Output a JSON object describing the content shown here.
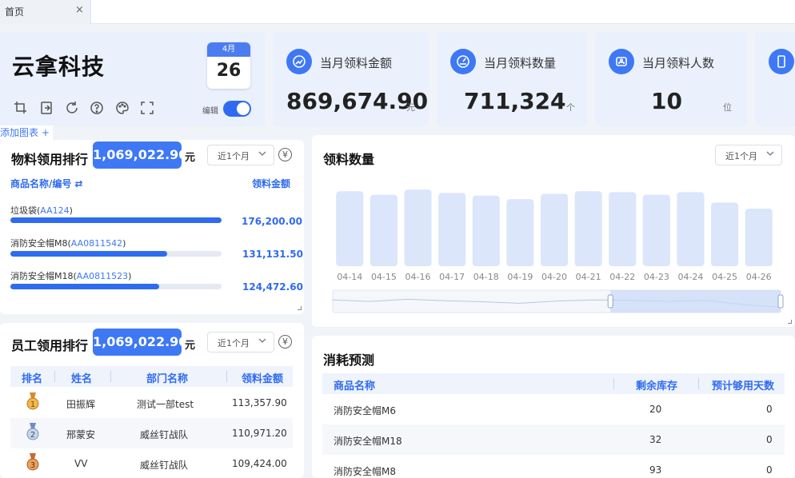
{
  "tab": {
    "label": "首页",
    "close": "×"
  },
  "company": {
    "name": "云拿科技",
    "month": "4月",
    "day": "26",
    "edit_label": "编辑"
  },
  "stats": [
    {
      "label": "当月领料金额",
      "value": "869,674.90",
      "unit": "元",
      "icon": "money-chart-icon"
    },
    {
      "label": "当月领料数量",
      "value": "711,324",
      "unit": "个",
      "icon": "gauge-icon"
    },
    {
      "label": "当月领料人数",
      "value": "10",
      "unit": "位",
      "icon": "people-icon"
    }
  ],
  "add_chart": "添加图表 +",
  "material_rank": {
    "title": "物料领用排行",
    "total": "1,069,022.90",
    "unit": "元",
    "range": "近1个月",
    "col_name": "商品名称/编号 ⇄",
    "col_amount": "领料金额",
    "items": [
      {
        "name": "垃圾袋",
        "code": "AA124",
        "amount": "176,200.00",
        "fraction": 1.0
      },
      {
        "name": "消防安全帽M8",
        "code": "AA0811542",
        "amount": "131,131.50",
        "fraction": 0.744
      },
      {
        "name": "消防安全帽M18",
        "code": "AA0811523",
        "amount": "124,472.60",
        "fraction": 0.706
      }
    ]
  },
  "employee_rank": {
    "title": "员工领用排行",
    "total": "1,069,022.90",
    "unit": "元",
    "range": "近1个月",
    "headers": [
      "排名",
      "姓名",
      "部门名称",
      "领料金额"
    ],
    "rows": [
      {
        "rank": "1",
        "name": "田振辉",
        "dept": "测试一部test",
        "amount": "113,357.90"
      },
      {
        "rank": "2",
        "name": "邢蒙安",
        "dept": "威丝钉战队",
        "amount": "110,971.20"
      },
      {
        "rank": "3",
        "name": "VV",
        "dept": "威丝钉战队",
        "amount": "109,424.00"
      }
    ]
  },
  "quantity_chart": {
    "title": "领料数量",
    "range": "近1个月"
  },
  "chart_data": {
    "type": "bar",
    "title": "领料数量",
    "categories": [
      "04-14",
      "04-15",
      "04-16",
      "04-17",
      "04-18",
      "04-19",
      "04-20",
      "04-21",
      "04-22",
      "04-23",
      "04-24",
      "04-25",
      "04-26"
    ],
    "values": [
      86,
      82,
      88,
      84,
      81,
      77,
      83,
      86,
      85,
      82,
      85,
      73,
      66
    ],
    "ylim": [
      0,
      100
    ],
    "grid": false,
    "legend": "none",
    "colors": {
      "bar": "#dbe6fb",
      "slider": "#c9d8f6"
    }
  },
  "forecast": {
    "title": "消耗预测",
    "headers": [
      "商品名称",
      "剩余库存",
      "预计够用天数"
    ],
    "rows": [
      {
        "name": "消防安全帽M6",
        "stock": "20",
        "days": "0"
      },
      {
        "name": "消防安全帽M18",
        "stock": "32",
        "days": "0"
      },
      {
        "name": "消防安全帽M8",
        "stock": "93",
        "days": "0"
      }
    ]
  }
}
